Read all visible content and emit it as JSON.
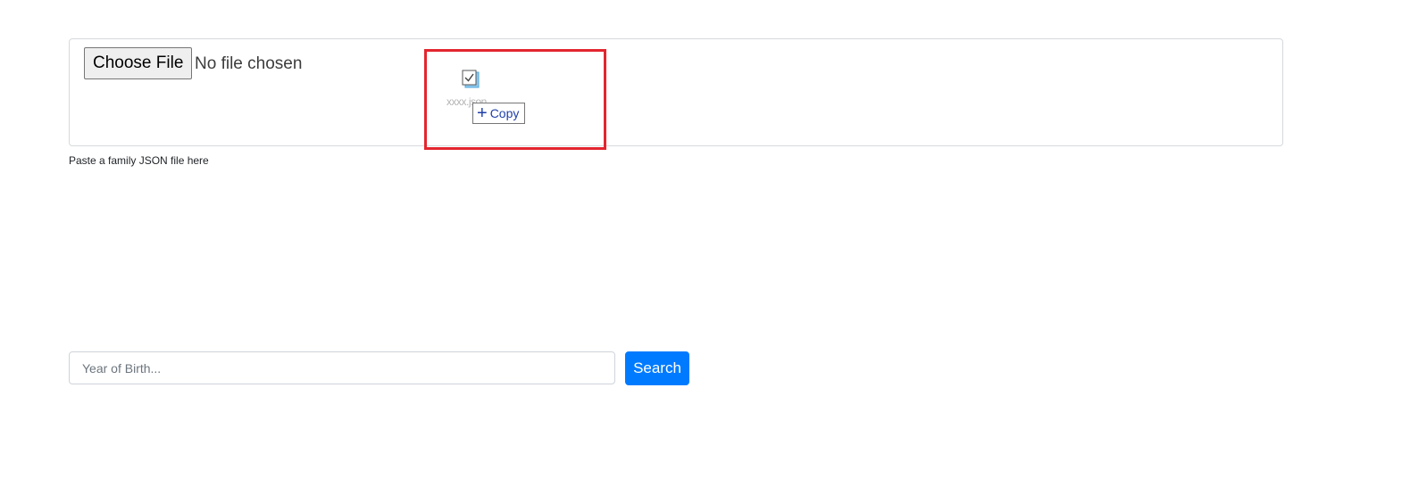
{
  "file_upload": {
    "button_label": "Choose File",
    "status_text": "No file chosen",
    "helper_text": "Paste a family JSON file here"
  },
  "drag_overlay": {
    "file_name": "xxxx.json",
    "file_icon": "json-file-icon",
    "action_icon": "plus-icon",
    "action_label": "Copy",
    "highlight_color": "#e3252f"
  },
  "search": {
    "placeholder": "Year of Birth...",
    "button_label": "Search",
    "button_color": "#007bff"
  }
}
